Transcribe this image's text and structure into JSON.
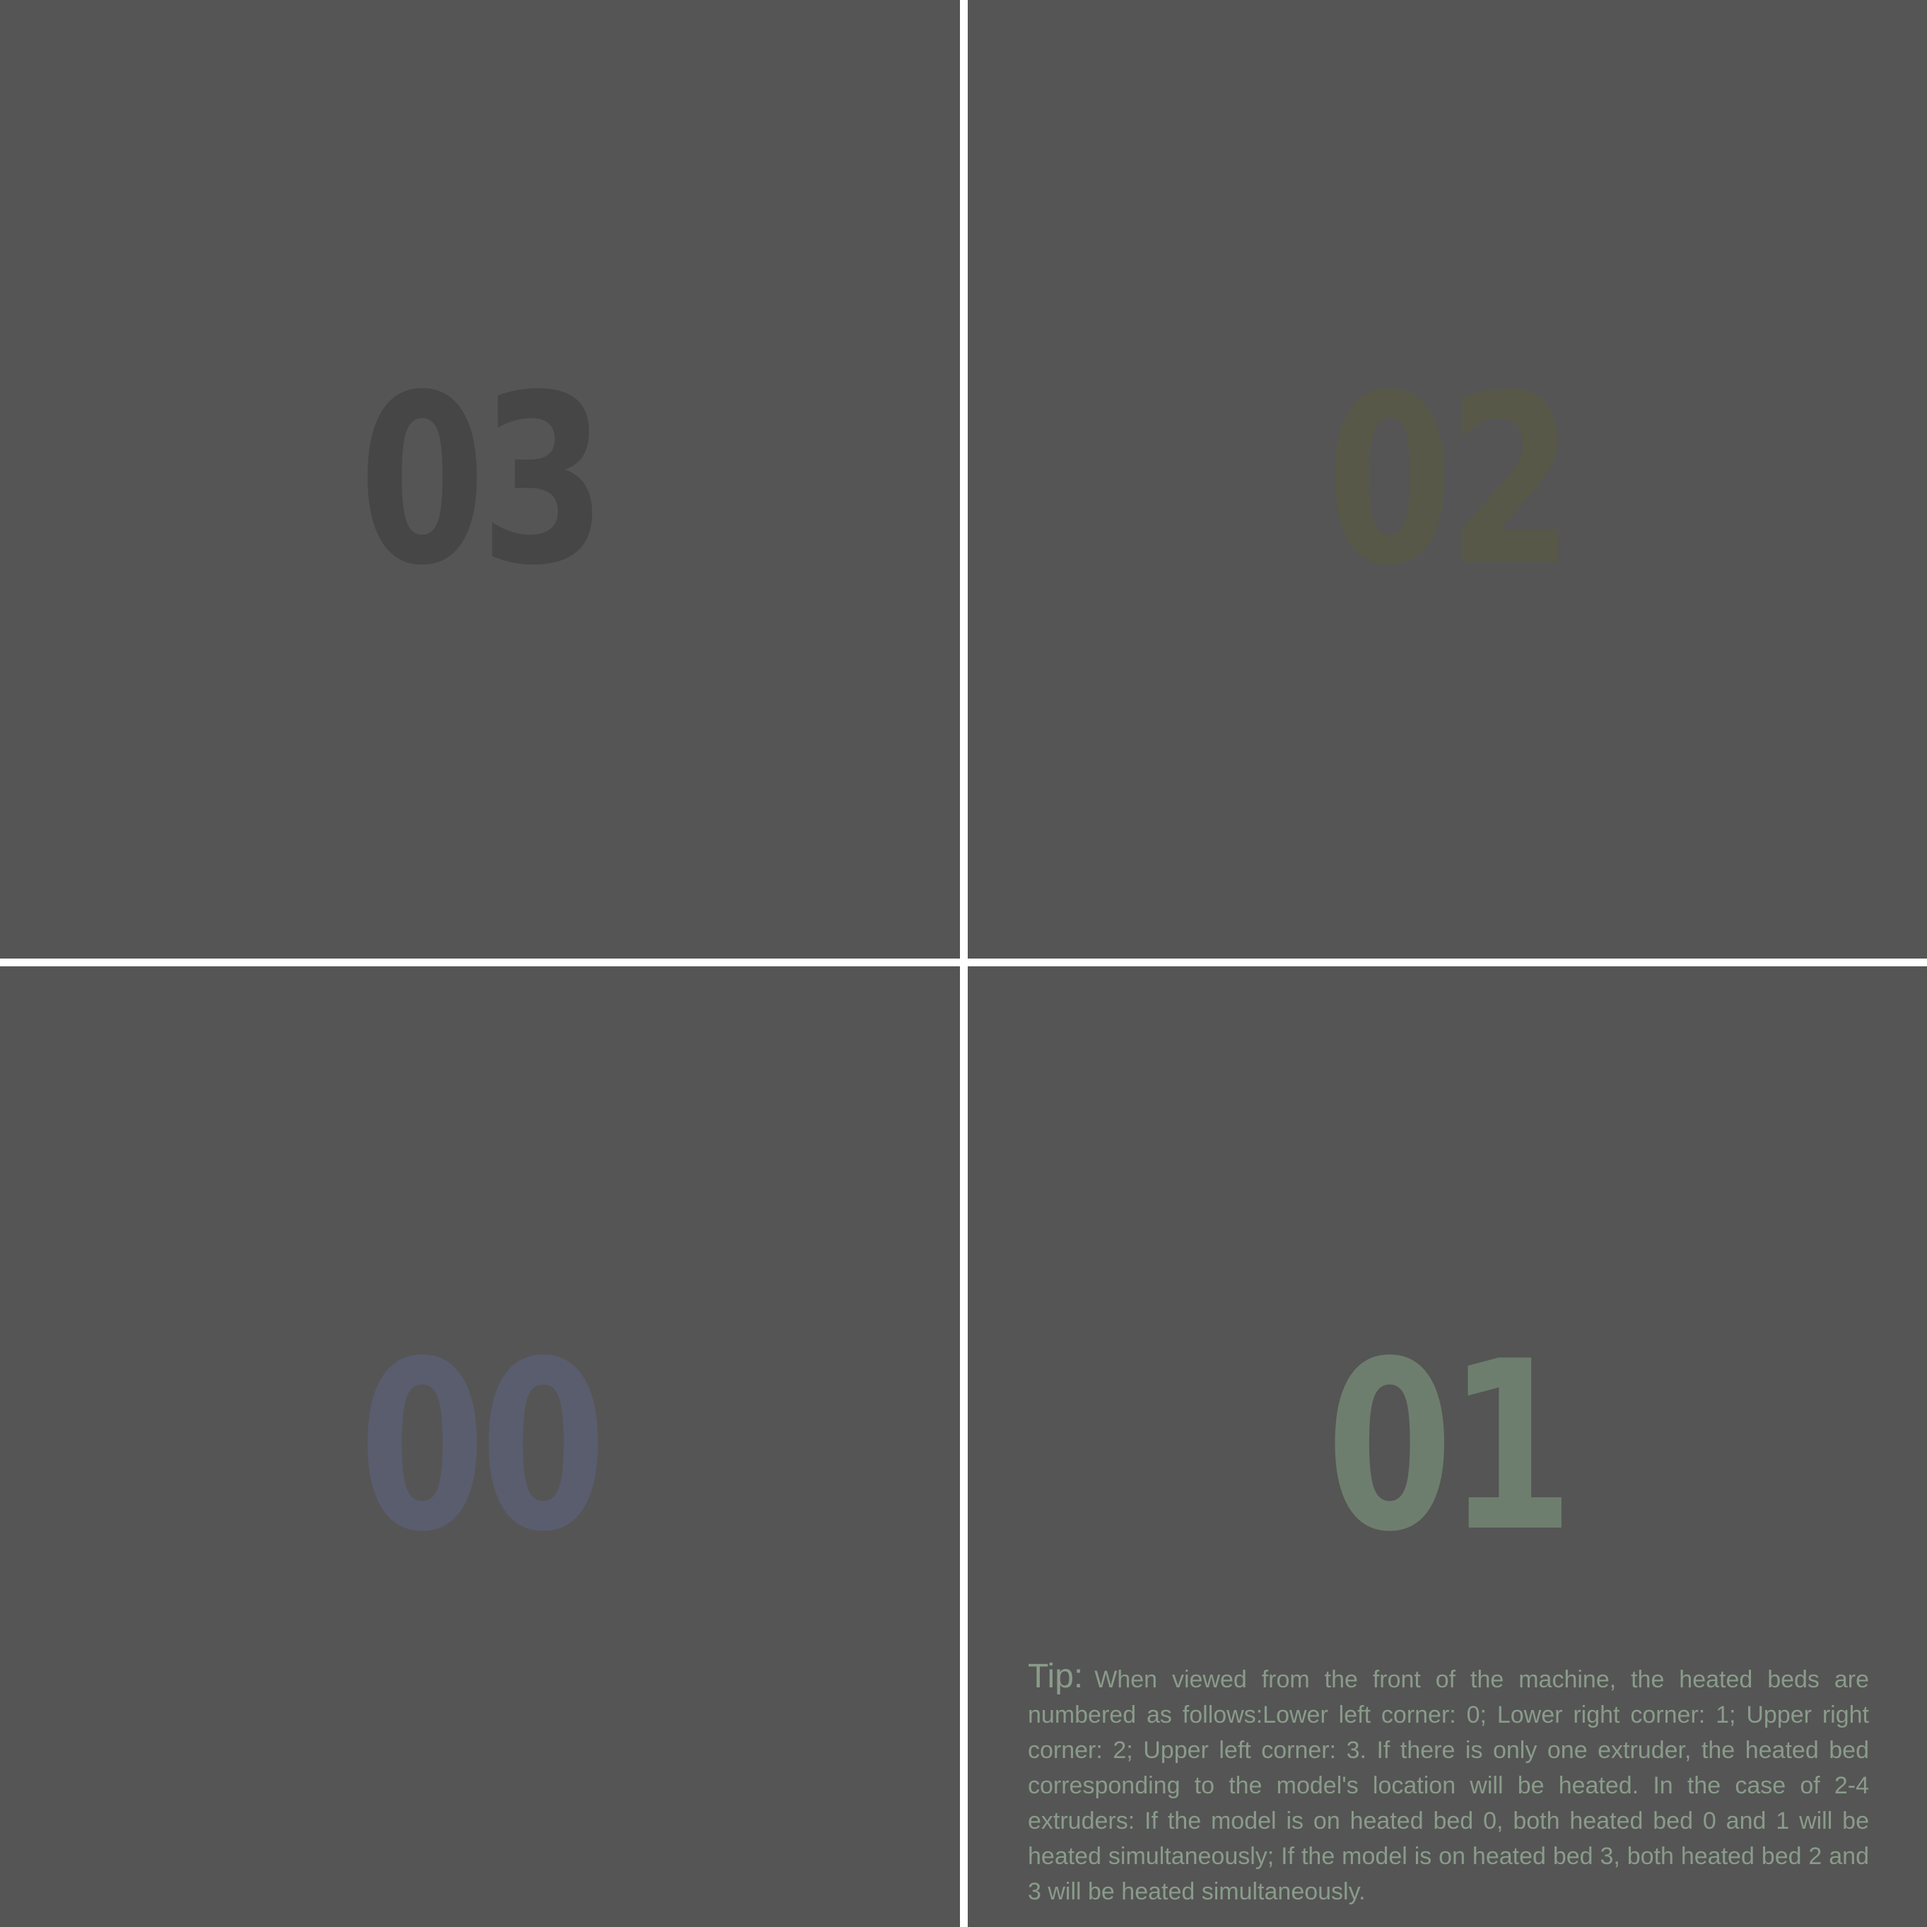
{
  "beds": {
    "upper_left": {
      "number": "03",
      "color": "#464646"
    },
    "upper_right": {
      "number": "02",
      "color": "#585848"
    },
    "lower_left": {
      "number": "00",
      "color": "#5a5d6e"
    },
    "lower_right": {
      "number": "01",
      "color": "#6e7e6e"
    }
  },
  "tip": {
    "label": "Tip:",
    "text": "When viewed from the front of the machine, the heated beds are numbered as follows:Lower left corner: 0; Lower right corner: 1; Upper right corner: 2; Upper left corner: 3. If there is only one extruder, the heated bed corresponding to the model's location will be heated. In the case of 2-4 extruders: If the model is on heated bed 0, both heated bed 0 and 1 will be heated simultaneously; If the model is on heated bed 3, both heated bed 2 and 3 will be heated simultaneously.",
    "color": "#8a9b8a"
  },
  "colors": {
    "bed_surface": "#555555",
    "gap": "#ffffff"
  }
}
